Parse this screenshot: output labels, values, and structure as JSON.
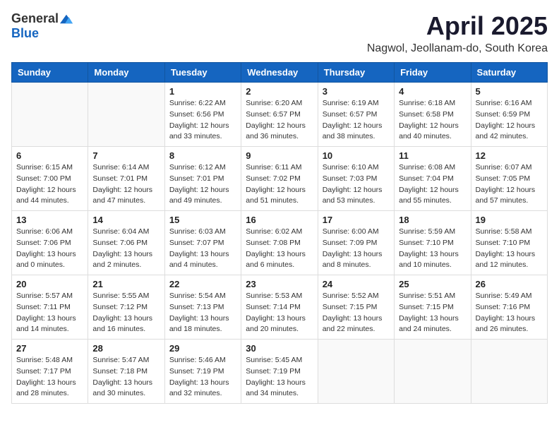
{
  "logo": {
    "general": "General",
    "blue": "Blue"
  },
  "title": "April 2025",
  "location": "Nagwol, Jeollanam-do, South Korea",
  "days_of_week": [
    "Sunday",
    "Monday",
    "Tuesday",
    "Wednesday",
    "Thursday",
    "Friday",
    "Saturday"
  ],
  "weeks": [
    [
      {
        "day": "",
        "info": ""
      },
      {
        "day": "",
        "info": ""
      },
      {
        "day": "1",
        "info": "Sunrise: 6:22 AM\nSunset: 6:56 PM\nDaylight: 12 hours\nand 33 minutes."
      },
      {
        "day": "2",
        "info": "Sunrise: 6:20 AM\nSunset: 6:57 PM\nDaylight: 12 hours\nand 36 minutes."
      },
      {
        "day": "3",
        "info": "Sunrise: 6:19 AM\nSunset: 6:57 PM\nDaylight: 12 hours\nand 38 minutes."
      },
      {
        "day": "4",
        "info": "Sunrise: 6:18 AM\nSunset: 6:58 PM\nDaylight: 12 hours\nand 40 minutes."
      },
      {
        "day": "5",
        "info": "Sunrise: 6:16 AM\nSunset: 6:59 PM\nDaylight: 12 hours\nand 42 minutes."
      }
    ],
    [
      {
        "day": "6",
        "info": "Sunrise: 6:15 AM\nSunset: 7:00 PM\nDaylight: 12 hours\nand 44 minutes."
      },
      {
        "day": "7",
        "info": "Sunrise: 6:14 AM\nSunset: 7:01 PM\nDaylight: 12 hours\nand 47 minutes."
      },
      {
        "day": "8",
        "info": "Sunrise: 6:12 AM\nSunset: 7:01 PM\nDaylight: 12 hours\nand 49 minutes."
      },
      {
        "day": "9",
        "info": "Sunrise: 6:11 AM\nSunset: 7:02 PM\nDaylight: 12 hours\nand 51 minutes."
      },
      {
        "day": "10",
        "info": "Sunrise: 6:10 AM\nSunset: 7:03 PM\nDaylight: 12 hours\nand 53 minutes."
      },
      {
        "day": "11",
        "info": "Sunrise: 6:08 AM\nSunset: 7:04 PM\nDaylight: 12 hours\nand 55 minutes."
      },
      {
        "day": "12",
        "info": "Sunrise: 6:07 AM\nSunset: 7:05 PM\nDaylight: 12 hours\nand 57 minutes."
      }
    ],
    [
      {
        "day": "13",
        "info": "Sunrise: 6:06 AM\nSunset: 7:06 PM\nDaylight: 13 hours\nand 0 minutes."
      },
      {
        "day": "14",
        "info": "Sunrise: 6:04 AM\nSunset: 7:06 PM\nDaylight: 13 hours\nand 2 minutes."
      },
      {
        "day": "15",
        "info": "Sunrise: 6:03 AM\nSunset: 7:07 PM\nDaylight: 13 hours\nand 4 minutes."
      },
      {
        "day": "16",
        "info": "Sunrise: 6:02 AM\nSunset: 7:08 PM\nDaylight: 13 hours\nand 6 minutes."
      },
      {
        "day": "17",
        "info": "Sunrise: 6:00 AM\nSunset: 7:09 PM\nDaylight: 13 hours\nand 8 minutes."
      },
      {
        "day": "18",
        "info": "Sunrise: 5:59 AM\nSunset: 7:10 PM\nDaylight: 13 hours\nand 10 minutes."
      },
      {
        "day": "19",
        "info": "Sunrise: 5:58 AM\nSunset: 7:10 PM\nDaylight: 13 hours\nand 12 minutes."
      }
    ],
    [
      {
        "day": "20",
        "info": "Sunrise: 5:57 AM\nSunset: 7:11 PM\nDaylight: 13 hours\nand 14 minutes."
      },
      {
        "day": "21",
        "info": "Sunrise: 5:55 AM\nSunset: 7:12 PM\nDaylight: 13 hours\nand 16 minutes."
      },
      {
        "day": "22",
        "info": "Sunrise: 5:54 AM\nSunset: 7:13 PM\nDaylight: 13 hours\nand 18 minutes."
      },
      {
        "day": "23",
        "info": "Sunrise: 5:53 AM\nSunset: 7:14 PM\nDaylight: 13 hours\nand 20 minutes."
      },
      {
        "day": "24",
        "info": "Sunrise: 5:52 AM\nSunset: 7:15 PM\nDaylight: 13 hours\nand 22 minutes."
      },
      {
        "day": "25",
        "info": "Sunrise: 5:51 AM\nSunset: 7:15 PM\nDaylight: 13 hours\nand 24 minutes."
      },
      {
        "day": "26",
        "info": "Sunrise: 5:49 AM\nSunset: 7:16 PM\nDaylight: 13 hours\nand 26 minutes."
      }
    ],
    [
      {
        "day": "27",
        "info": "Sunrise: 5:48 AM\nSunset: 7:17 PM\nDaylight: 13 hours\nand 28 minutes."
      },
      {
        "day": "28",
        "info": "Sunrise: 5:47 AM\nSunset: 7:18 PM\nDaylight: 13 hours\nand 30 minutes."
      },
      {
        "day": "29",
        "info": "Sunrise: 5:46 AM\nSunset: 7:19 PM\nDaylight: 13 hours\nand 32 minutes."
      },
      {
        "day": "30",
        "info": "Sunrise: 5:45 AM\nSunset: 7:19 PM\nDaylight: 13 hours\nand 34 minutes."
      },
      {
        "day": "",
        "info": ""
      },
      {
        "day": "",
        "info": ""
      },
      {
        "day": "",
        "info": ""
      }
    ]
  ]
}
